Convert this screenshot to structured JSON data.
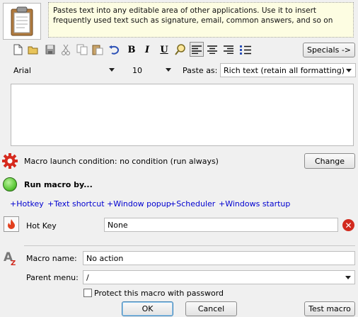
{
  "header": {
    "description": "Pastes text into any editable area of other applications. Use it to insert frequently used text such as signature, email, common answers, and so on",
    "app_icon": "clipboard-icon"
  },
  "toolbar": {
    "specials_label": "Specials ->",
    "buttons": [
      "new-document-icon",
      "open-folder-icon",
      "save-icon",
      "cut-icon",
      "copy-icon",
      "paste-icon",
      "undo-icon",
      "bold-icon",
      "italic-icon",
      "underline-icon",
      "find-icon",
      "align-left-icon",
      "align-center-icon",
      "align-right-icon",
      "bullet-list-icon"
    ],
    "selected_alignment": "align-left"
  },
  "format": {
    "font": "Arial",
    "size": "10",
    "paste_as_label": "Paste as:",
    "paste_as_value": "Rich text (retain all formatting)"
  },
  "editor": {
    "content": ""
  },
  "condition": {
    "text": "Macro launch condition: no condition (run always)",
    "change_label": "Change"
  },
  "run": {
    "title": "Run macro by...",
    "links": [
      "+Hotkey",
      "+Text shortcut",
      "+Window popup",
      "+Scheduler",
      "+Windows startup"
    ]
  },
  "hotkey": {
    "label": "Hot Key",
    "value": "None"
  },
  "macro": {
    "name_label": "Macro name:",
    "name_value": "No action",
    "parent_label": "Parent menu:",
    "parent_value": "/",
    "protect_label": "Protect this macro with password",
    "protect_checked": false
  },
  "buttons": {
    "ok": "OK",
    "cancel": "Cancel",
    "test": "Test macro"
  },
  "colors": {
    "link": "#0000d0",
    "description_bg": "#fdfde2",
    "condition_icon": "#d62a1e",
    "run_icon": "#5ec93a"
  }
}
